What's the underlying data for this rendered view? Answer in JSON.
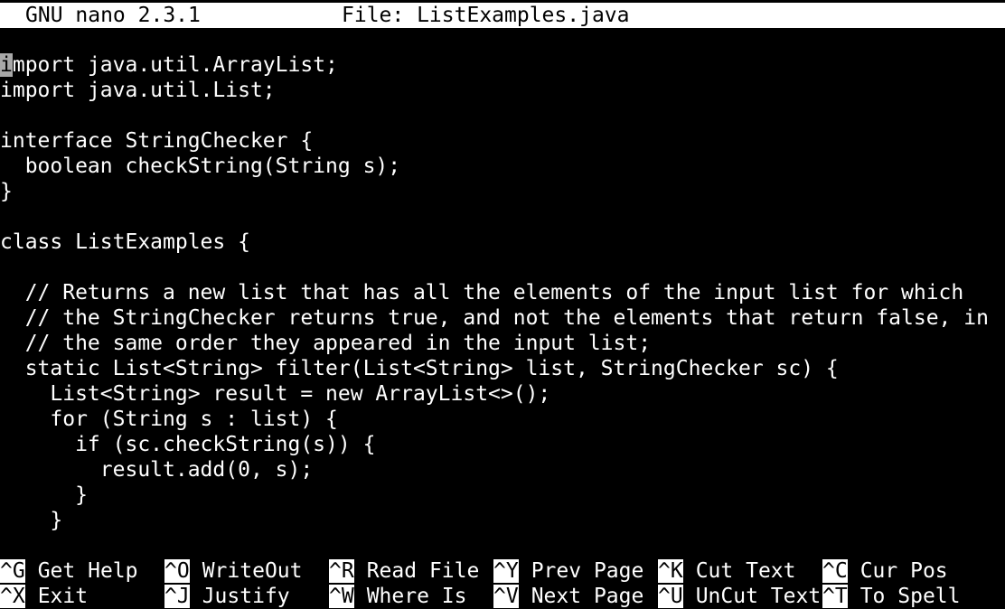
{
  "titlebar": {
    "app": "GNU nano 2.3.1",
    "file": "File: ListExamples.java"
  },
  "editor": {
    "cursor_char": "i",
    "lines": [
      "mport java.util.ArrayList;",
      "import java.util.List;",
      "",
      "interface StringChecker {",
      "  boolean checkString(String s);",
      "}",
      "",
      "class ListExamples {",
      "",
      "  // Returns a new list that has all the elements of the input list for which",
      "  // the StringChecker returns true, and not the elements that return false, in",
      "  // the same order they appeared in the input list;",
      "  static List<String> filter(List<String> list, StringChecker sc) {",
      "    List<String> result = new ArrayList<>();",
      "    for (String s : list) {",
      "      if (sc.checkString(s)) {",
      "        result.add(0, s);",
      "      }",
      "    }"
    ]
  },
  "shortcuts": {
    "row1": [
      {
        "key": "^G",
        "label": "Get Help"
      },
      {
        "key": "^O",
        "label": "WriteOut"
      },
      {
        "key": "^R",
        "label": "Read File"
      },
      {
        "key": "^Y",
        "label": "Prev Page"
      },
      {
        "key": "^K",
        "label": "Cut Text"
      },
      {
        "key": "^C",
        "label": "Cur Pos"
      }
    ],
    "row2": [
      {
        "key": "^X",
        "label": "Exit"
      },
      {
        "key": "^J",
        "label": "Justify"
      },
      {
        "key": "^W",
        "label": "Where Is"
      },
      {
        "key": "^V",
        "label": "Next Page"
      },
      {
        "key": "^U",
        "label": "UnCut Text"
      },
      {
        "key": "^T",
        "label": "To Spell"
      }
    ]
  }
}
